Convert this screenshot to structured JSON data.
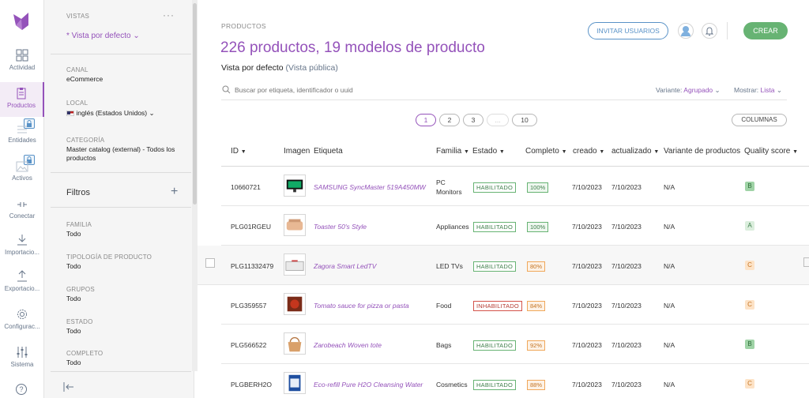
{
  "nav": {
    "items": [
      {
        "label": "Actividad",
        "icon": "dashboard-icon"
      },
      {
        "label": "Productos",
        "icon": "clipboard-icon"
      },
      {
        "label": "Entidades",
        "icon": "list-icon"
      },
      {
        "label": "Activos",
        "icon": "image-icon"
      },
      {
        "label": "Conectar",
        "icon": "connect-icon"
      },
      {
        "label": "Importacio...",
        "icon": "import-icon"
      },
      {
        "label": "Exportacio...",
        "icon": "export-icon"
      },
      {
        "label": "Configurac...",
        "icon": "gear-icon"
      },
      {
        "label": "Sistema",
        "icon": "sliders-icon"
      }
    ],
    "help": "?"
  },
  "panel": {
    "views_label": "VISTAS",
    "current_view": "* Vista por defecto",
    "channel_label": "CANAL",
    "channel_value": "eCommerce",
    "locale_label": "LOCAL",
    "locale_value": "inglés (Estados Unidos)",
    "category_label": "CATEGORÍA",
    "category_value_1": "Master catalog (external) - Todos los",
    "category_value_2": "productos",
    "filters_title": "Filtros",
    "filters": [
      {
        "label": "FAMILIA",
        "value": "Todo"
      },
      {
        "label": "TIPOLOGÍA DE PRODUCTO",
        "value": "Todo"
      },
      {
        "label": "GRUPOS",
        "value": "Todo"
      },
      {
        "label": "ESTADO",
        "value": "Todo"
      },
      {
        "label": "COMPLETO",
        "value": "Todo"
      }
    ]
  },
  "header": {
    "breadcrumb": "PRODUCTOS",
    "title": "226 productos, 19 modelos de producto",
    "view_name": "Vista por defecto",
    "view_scope": "(Vista pública)",
    "invite_label": "INVITAR USUARIOS",
    "create_label": "CREAR"
  },
  "toolbar": {
    "search_placeholder": "Buscar por etiqueta, identificador o uuid",
    "variant_label": "Variante:",
    "variant_value": "Agrupado",
    "show_label": "Mostrar:",
    "show_value": "Lista",
    "columns_label": "COLUMNAS"
  },
  "pagination": [
    "1",
    "2",
    "3",
    "...",
    "10"
  ],
  "table": {
    "columns": [
      "ID",
      "Imagen",
      "Etiqueta",
      "Familia",
      "Estado",
      "Completo",
      "creado",
      "actualizado",
      "Variante de productos",
      "Quality score"
    ],
    "rows": [
      {
        "id": "10660721",
        "label": "SAMSUNG SyncMaster 519A450MW",
        "family_1": "PC",
        "family_2": "Monitors",
        "status": "HABILITADO",
        "complete": "100%",
        "created": "7/10/2023",
        "updated": "7/10/2023",
        "variant": "N/A",
        "score": "B"
      },
      {
        "id": "PLG01RGEU",
        "label": "Toaster 50's Style",
        "family_1": "Appliances",
        "family_2": "",
        "status": "HABILITADO",
        "complete": "100%",
        "created": "7/10/2023",
        "updated": "7/10/2023",
        "variant": "N/A",
        "score": "A"
      },
      {
        "id": "PLG11332479",
        "label": "Zagora Smart LedTV",
        "family_1": "LED TVs",
        "family_2": "",
        "status": "HABILITADO",
        "complete": "80%",
        "created": "7/10/2023",
        "updated": "7/10/2023",
        "variant": "N/A",
        "score": "C"
      },
      {
        "id": "PLG359557",
        "label": "Tomato sauce for pizza or pasta",
        "family_1": "Food",
        "family_2": "",
        "status": "INHABILITADO",
        "complete": "84%",
        "created": "7/10/2023",
        "updated": "7/10/2023",
        "variant": "N/A",
        "score": "C"
      },
      {
        "id": "PLG566522",
        "label": "Zarobeach Woven tote",
        "family_1": "Bags",
        "family_2": "",
        "status": "HABILITADO",
        "complete": "92%",
        "created": "7/10/2023",
        "updated": "7/10/2023",
        "variant": "N/A",
        "score": "B"
      },
      {
        "id": "PLGBERH2O",
        "label": "Eco-refill Pure H2O Cleansing Water",
        "family_1": "Cosmetics",
        "family_2": "",
        "status": "HABILITADO",
        "complete": "88%",
        "created": "7/10/2023",
        "updated": "7/10/2023",
        "variant": "N/A",
        "score": "C"
      }
    ]
  },
  "colors": {
    "accent": "#9452ba",
    "blue": "#5992c7",
    "green": "#67b373",
    "red": "#d4534a",
    "orange": "#f0a85b"
  }
}
